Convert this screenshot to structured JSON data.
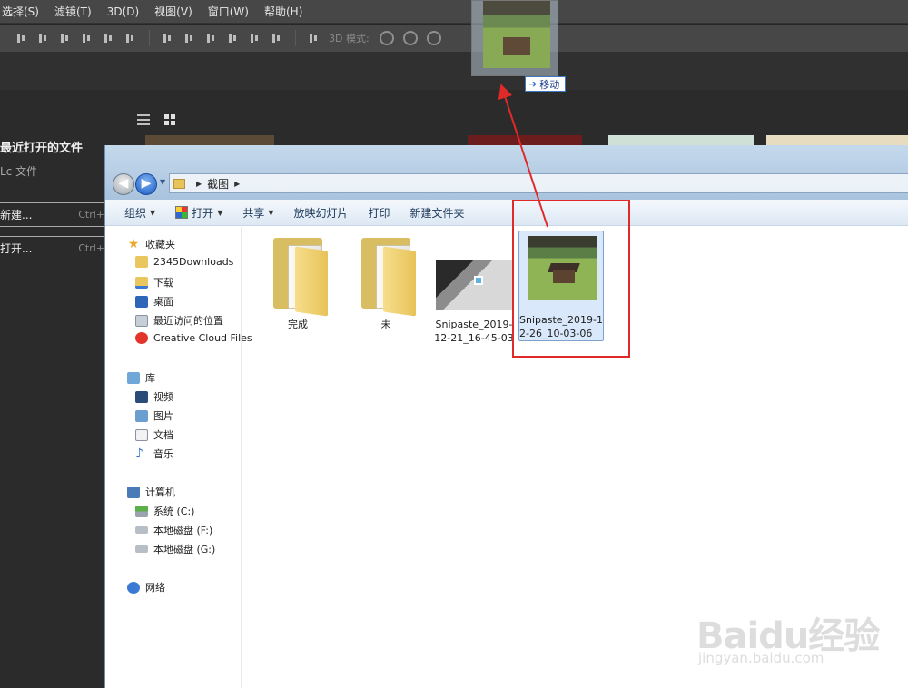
{
  "ps": {
    "menu": [
      "选择(S)",
      "滤镜(T)",
      "3D(D)",
      "视图(V)",
      "窗口(W)",
      "帮助(H)"
    ],
    "mode_label": "3D 模式:",
    "recent_title": "最近打开的文件",
    "lc_files": "Lc 文件",
    "new_label": "新建...",
    "new_shortcut": "Ctrl+",
    "open_label": "打开...",
    "open_shortcut": "Ctrl+"
  },
  "drag": {
    "tooltip": "移动"
  },
  "explorer": {
    "path": "截图",
    "toolbar": {
      "organize": "组织",
      "open": "打开",
      "share": "共享",
      "slideshow": "放映幻灯片",
      "print": "打印",
      "new_folder": "新建文件夹"
    },
    "nav": {
      "favorites": "收藏夹",
      "downloads_2345": "2345Downloads",
      "downloads": "下载",
      "desktop": "桌面",
      "recent": "最近访问的位置",
      "creative_cloud": "Creative Cloud Files",
      "libraries": "库",
      "videos": "视频",
      "pictures": "图片",
      "documents": "文档",
      "music": "音乐",
      "computer": "计算机",
      "drive_c": "系统 (C:)",
      "drive_f": "本地磁盘 (F:)",
      "drive_g": "本地磁盘 (G:)",
      "network": "网络"
    },
    "files": [
      {
        "name": "完成",
        "type": "folder"
      },
      {
        "name": "未",
        "type": "folder"
      },
      {
        "name": "Snipaste_2019-12-21_16-45-03",
        "type": "image"
      },
      {
        "name": "Snipaste_2019-12-26_10-03-06",
        "type": "image",
        "selected": true
      }
    ]
  },
  "watermark": {
    "logo": "Baidu经验",
    "url": "jingyan.baidu.com"
  },
  "colors": {
    "highlight_red": "#e02a2a",
    "selection_blue": "#d9e8fb",
    "ps_bg": "#2b2b2b"
  }
}
